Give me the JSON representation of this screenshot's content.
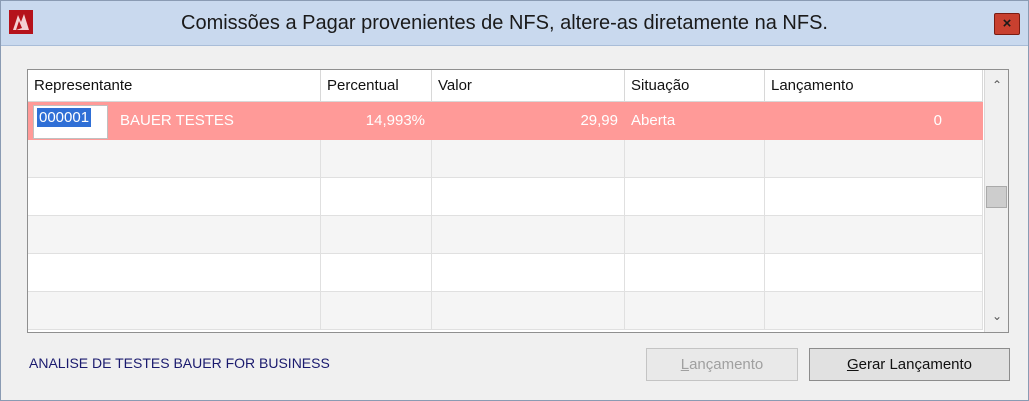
{
  "window": {
    "title": "Comissões a Pagar provenientes de NFS, altere-as diretamente na NFS.",
    "close_label": "×",
    "accent_color": "#ff9a98"
  },
  "grid": {
    "columns": [
      "Representante",
      "Percentual",
      "Valor",
      "Situação",
      "Lançamento"
    ],
    "rows": [
      {
        "codigo": "000001",
        "nome": "BAUER TESTES",
        "percentual": "14,993%",
        "valor": "29,99",
        "situacao": "Aberta",
        "lancamento": "0"
      }
    ]
  },
  "footer": {
    "status_text": "ANALISE DE TESTES BAUER FOR BUSINESS",
    "btn_lancamento_underline": "L",
    "btn_lancamento_rest": "ançamento",
    "btn_gerar_underline": "G",
    "btn_gerar_rest": "erar Lançamento"
  }
}
